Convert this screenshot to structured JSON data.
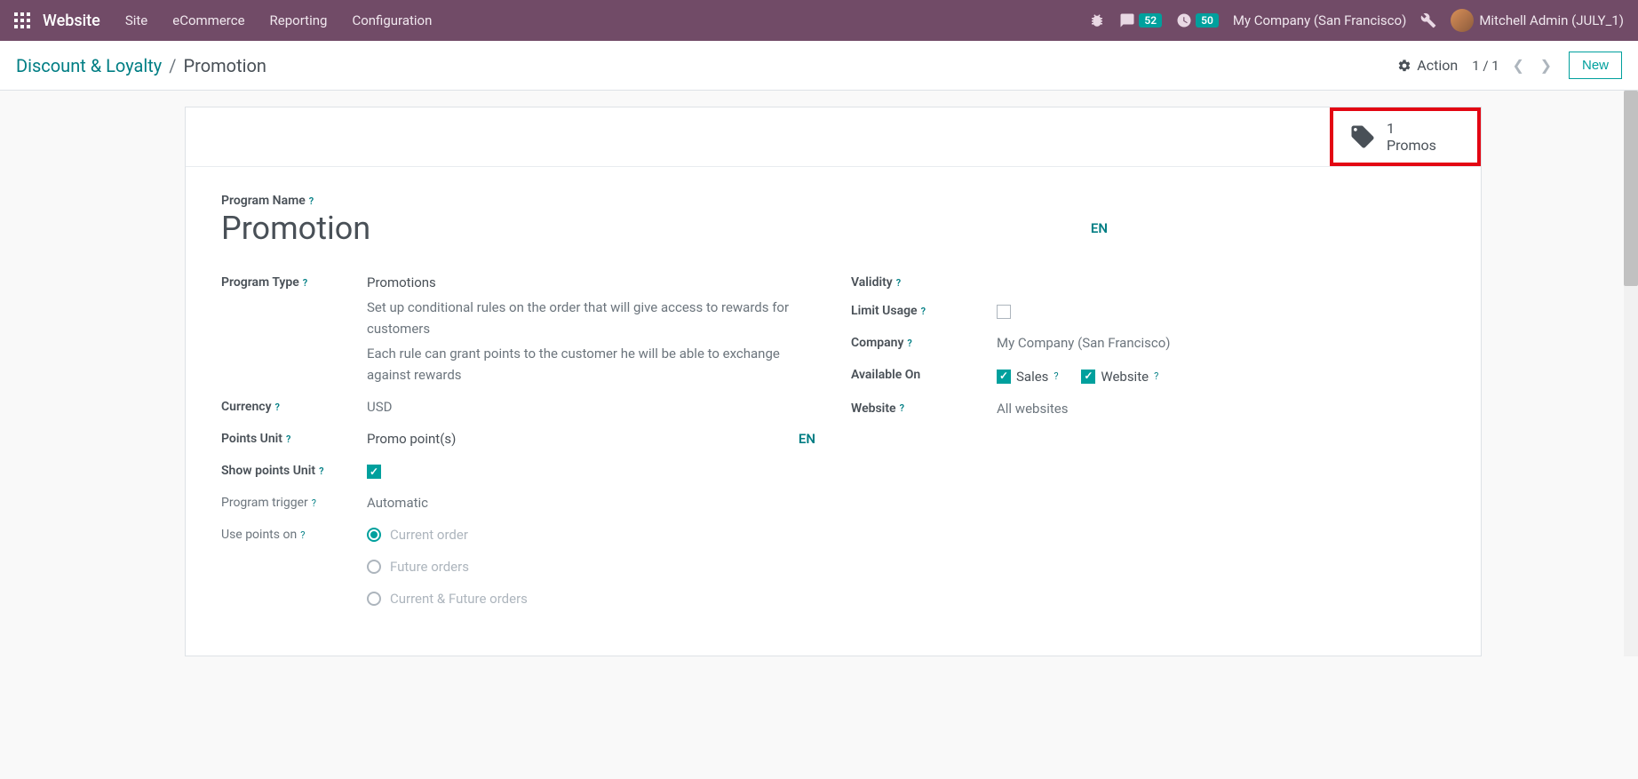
{
  "navbar": {
    "brand": "Website",
    "menu": [
      "Site",
      "eCommerce",
      "Reporting",
      "Configuration"
    ],
    "messages_count": "52",
    "activities_count": "50",
    "company": "My Company (San Francisco)",
    "user": "Mitchell Admin (JULY_1)"
  },
  "breadcrumb": {
    "parent": "Discount & Loyalty",
    "current": "Promotion"
  },
  "controls": {
    "action_label": "Action",
    "pager": "1 / 1",
    "new_label": "New"
  },
  "stat_button": {
    "value": "1",
    "label": "Promos"
  },
  "form": {
    "program_name_label": "Program Name",
    "program_name_value": "Promotion",
    "lang": "EN",
    "program_type_label": "Program Type",
    "program_type_value": "Promotions",
    "program_type_desc1": "Set up conditional rules on the order that will give access to rewards for customers",
    "program_type_desc2": "Each rule can grant points to the customer he will be able to exchange against rewards",
    "currency_label": "Currency",
    "currency_value": "USD",
    "points_unit_label": "Points Unit",
    "points_unit_value": "Promo point(s)",
    "show_points_label": "Show points Unit",
    "show_points_checked": true,
    "program_trigger_label": "Program trigger",
    "program_trigger_value": "Automatic",
    "use_points_label": "Use points on",
    "use_points_options": [
      "Current order",
      "Future orders",
      "Current & Future orders"
    ],
    "use_points_selected": 0,
    "validity_label": "Validity",
    "limit_usage_label": "Limit Usage",
    "limit_usage_checked": false,
    "company_label": "Company",
    "company_value": "My Company (San Francisco)",
    "available_on_label": "Available On",
    "available_sales_label": "Sales",
    "available_sales_checked": true,
    "available_website_label": "Website",
    "available_website_checked": true,
    "website_label": "Website",
    "website_placeholder": "All websites"
  }
}
